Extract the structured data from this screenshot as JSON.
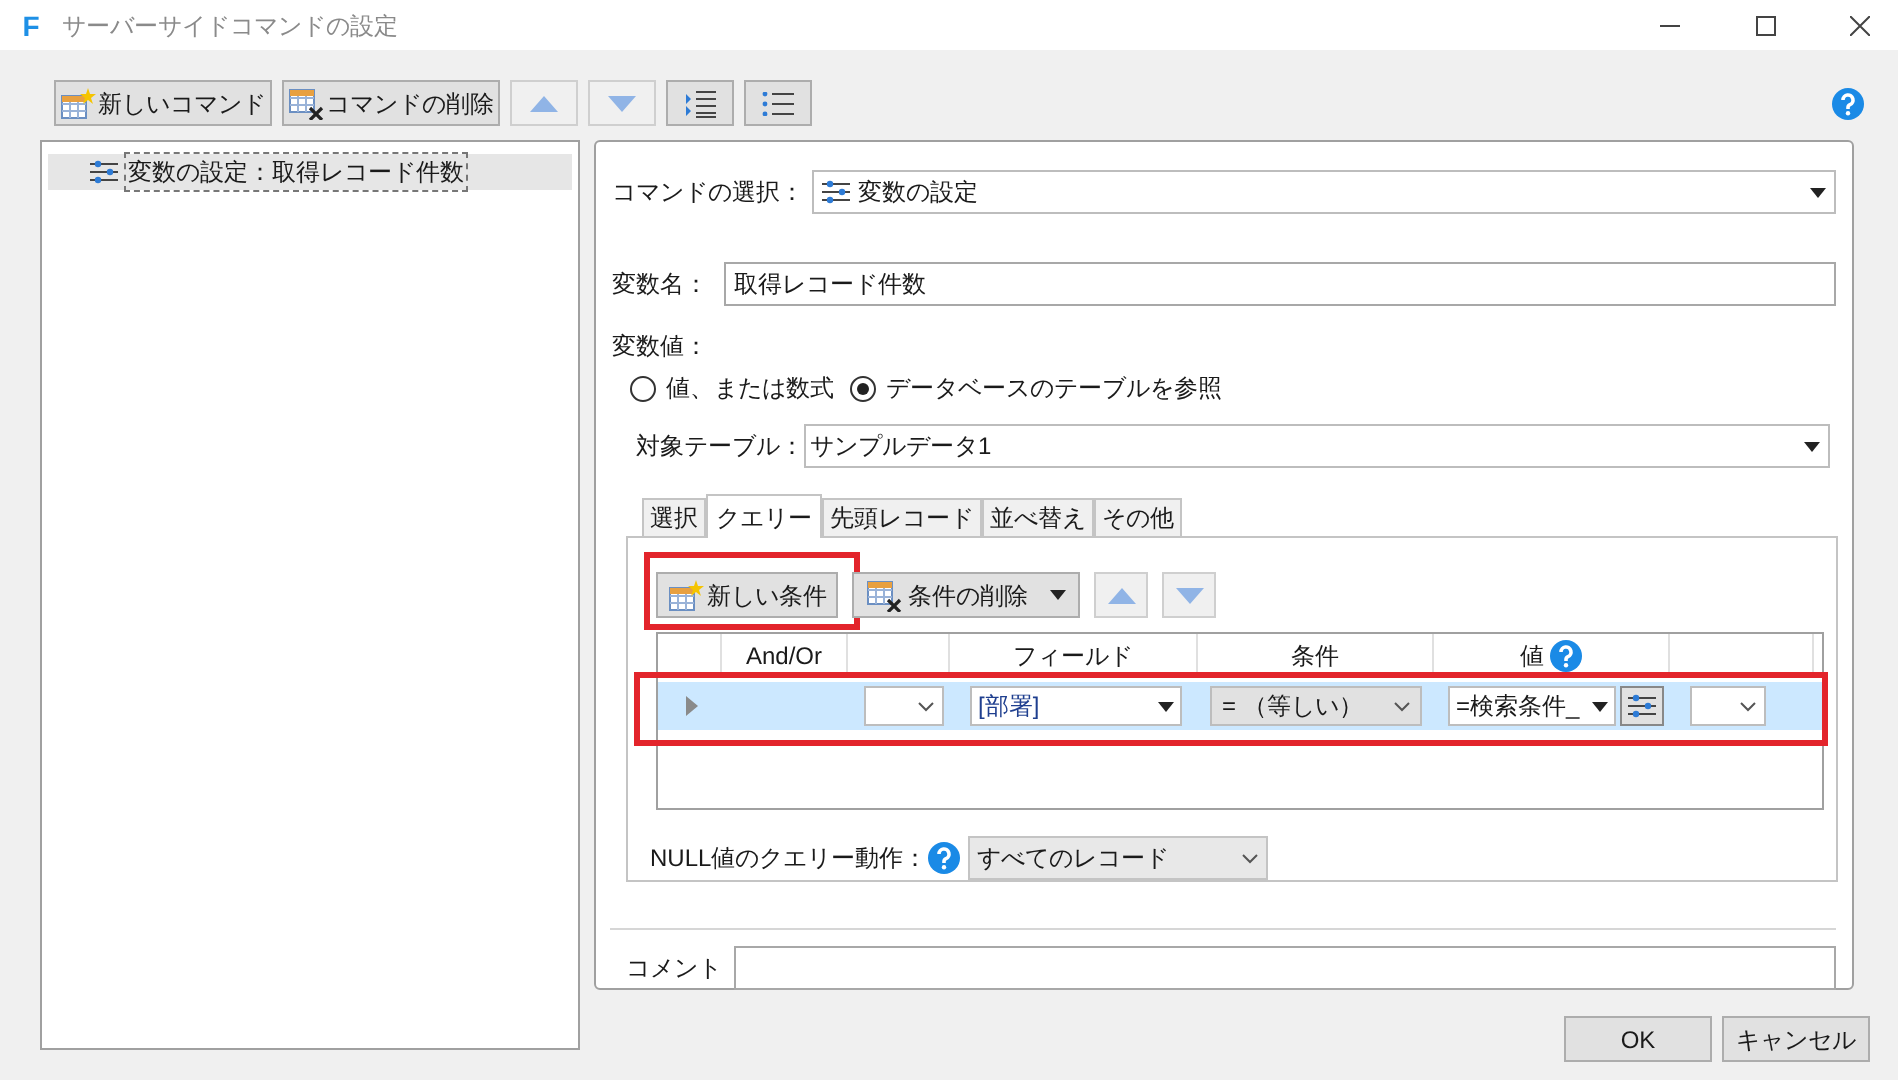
{
  "window": {
    "title": "サーバーサイドコマンドの設定",
    "icon_letter": "F"
  },
  "toolbar": [
    {
      "kind": "new",
      "label": "新しいコマンド"
    },
    {
      "kind": "delete",
      "label": "コマンドの削除"
    },
    {
      "kind": "up"
    },
    {
      "kind": "down"
    },
    {
      "kind": "indent"
    },
    {
      "kind": "list"
    }
  ],
  "command_tree": [
    {
      "label": "変数の設定：取得レコード件数",
      "selected": true
    }
  ],
  "command_select": {
    "label": "コマンドの選択：",
    "value": "変数の設定"
  },
  "variable_name": {
    "label": "変数名：",
    "value": "取得レコード件数"
  },
  "variable_value": {
    "label": "変数値：",
    "options": [
      {
        "label": "値、または数式",
        "selected": false
      },
      {
        "label": "データベースのテーブルを参照",
        "selected": true
      }
    ]
  },
  "target_table": {
    "label": "対象テーブル：",
    "value": "サンプルデータ1"
  },
  "tabs": [
    {
      "label": "選択",
      "selected": false
    },
    {
      "label": "クエリー",
      "selected": true
    },
    {
      "label": "先頭レコード",
      "selected": false
    },
    {
      "label": "並べ替え",
      "selected": false
    },
    {
      "label": "その他",
      "selected": false
    }
  ],
  "query": {
    "buttons": [
      {
        "kind": "new",
        "label": "新しい条件",
        "highlighted": true
      },
      {
        "kind": "delete",
        "label": "条件の削除",
        "highlighted": false
      },
      {
        "kind": "up",
        "highlighted": false
      },
      {
        "kind": "down",
        "highlighted": false
      }
    ],
    "columns": [
      {
        "label": "And/Or",
        "help": false
      },
      {
        "label": "フィールド",
        "help": false
      },
      {
        "label": "条件",
        "help": false
      },
      {
        "label": "値",
        "help": true
      }
    ],
    "rows": [
      {
        "selected": true,
        "highlighted": true,
        "field": "[部署]",
        "condition": "= （等しい）",
        "value": "=検索条件_"
      }
    ],
    "null_behavior": {
      "label": "NULL値のクエリー動作：",
      "value": "すべてのレコード"
    }
  },
  "comment": {
    "label": "コメント"
  },
  "buttons": [
    "OK",
    "キャンセル"
  ]
}
